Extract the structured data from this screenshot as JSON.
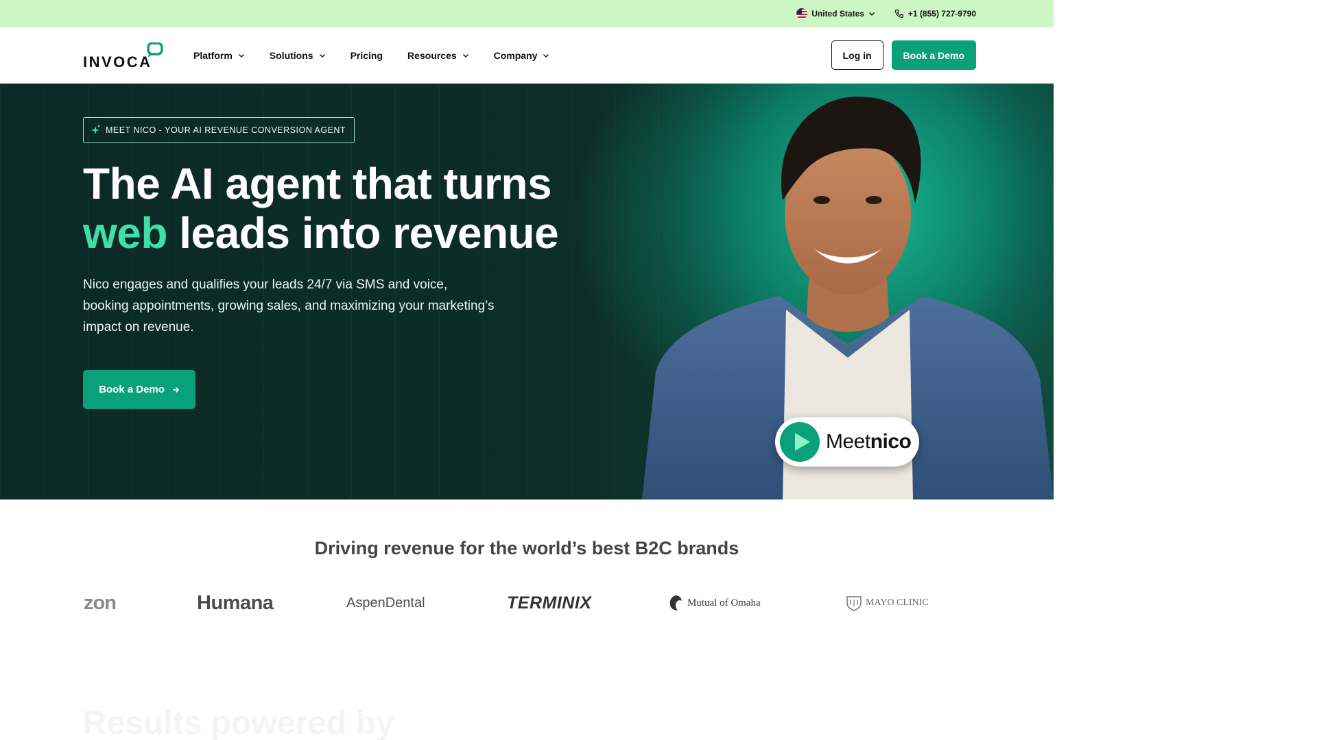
{
  "utility": {
    "country": "United States",
    "phone": "+1 (855) 727-9790"
  },
  "header": {
    "logo_text": "INVOCA",
    "nav": [
      {
        "label": "Platform",
        "has_dropdown": true
      },
      {
        "label": "Solutions",
        "has_dropdown": true
      },
      {
        "label": "Pricing",
        "has_dropdown": false
      },
      {
        "label": "Resources",
        "has_dropdown": true
      },
      {
        "label": "Company",
        "has_dropdown": true
      }
    ],
    "login_label": "Log in",
    "demo_label": "Book a Demo"
  },
  "hero": {
    "badge": "MEET NICO - YOUR AI REVENUE CONVERSION AGENT",
    "title_line1": "The AI agent that turns",
    "title_accent": "web",
    "title_line2_rest": " leads into revenue",
    "subtitle": "Nico engages and qualifies your leads 24/7 via SMS and voice, booking appointments, growing sales, and maximizing your marketing’s impact on revenue.",
    "cta_label": "Book a Demo",
    "meet_word": "Meet",
    "meet_name": "nico"
  },
  "brands": {
    "heading": "Driving revenue for the world’s best B2C brands",
    "logos": [
      "zon",
      "Humana",
      "AspenDental",
      "TERMINIX",
      "Mutual of Omaha",
      "MAYO CLINIC"
    ]
  },
  "next_section": {
    "heading": "Results powered by"
  },
  "colors": {
    "utility_bg": "#cdf7c5",
    "brand_green": "#0aa07a",
    "accent_text": "#3fe0a6",
    "hero_dark": "#0b2a25"
  }
}
